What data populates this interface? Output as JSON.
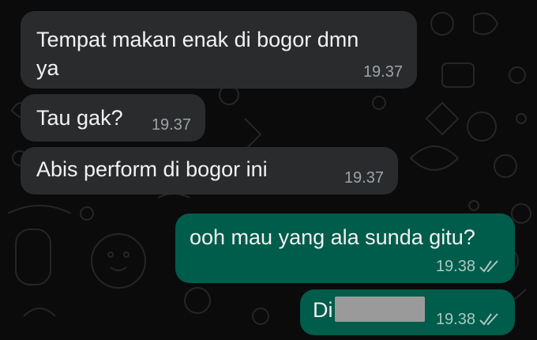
{
  "chat": {
    "messages": [
      {
        "direction": "incoming",
        "text_line1": "Tempat makan enak di bogor dmn",
        "text_line2": "ya",
        "time": "19.37"
      },
      {
        "direction": "incoming",
        "text": "Tau gak?",
        "time": "19.37"
      },
      {
        "direction": "incoming",
        "text": "Abis perform di bogor ini",
        "time": "19.37"
      },
      {
        "direction": "outgoing",
        "text": "ooh mau yang ala sunda gitu?",
        "time": "19.38",
        "status_icon": "double-check-icon"
      },
      {
        "direction": "outgoing",
        "text": "Di",
        "redacted": true,
        "time": "19.38",
        "status_icon": "double-check-icon"
      }
    ]
  },
  "colors": {
    "background": "#0b0b0b",
    "incoming_bubble": "#2a2b2d",
    "outgoing_bubble": "#005c4b",
    "text": "#f2f2f2",
    "timestamp": "#9ea3a6"
  }
}
